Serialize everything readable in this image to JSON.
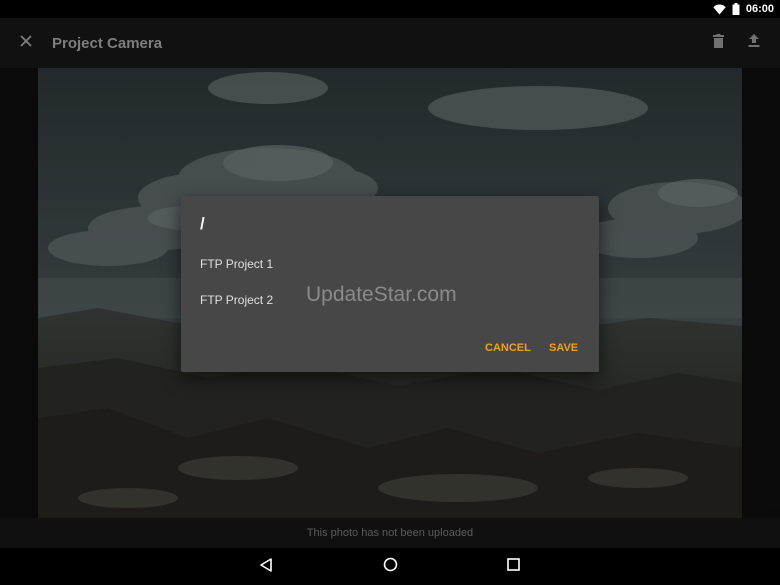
{
  "status_bar": {
    "time": "06:00",
    "icons": [
      "wifi-icon",
      "battery-icon"
    ]
  },
  "app_bar": {
    "title": "Project Camera",
    "close_icon": "close-icon",
    "actions": [
      "delete-icon",
      "upload-icon"
    ]
  },
  "photo": {
    "caption": "This photo has not been uploaded"
  },
  "dialog": {
    "path": "/",
    "items": [
      {
        "label": "FTP Project 1"
      },
      {
        "label": "FTP Project 2"
      }
    ],
    "cancel_label": "CANCEL",
    "save_label": "SAVE",
    "accent_color": "#F0A11A"
  },
  "watermark": "UpdateStar.com",
  "nav_bar": {
    "icons": [
      "back-icon",
      "home-icon",
      "recents-icon"
    ]
  }
}
